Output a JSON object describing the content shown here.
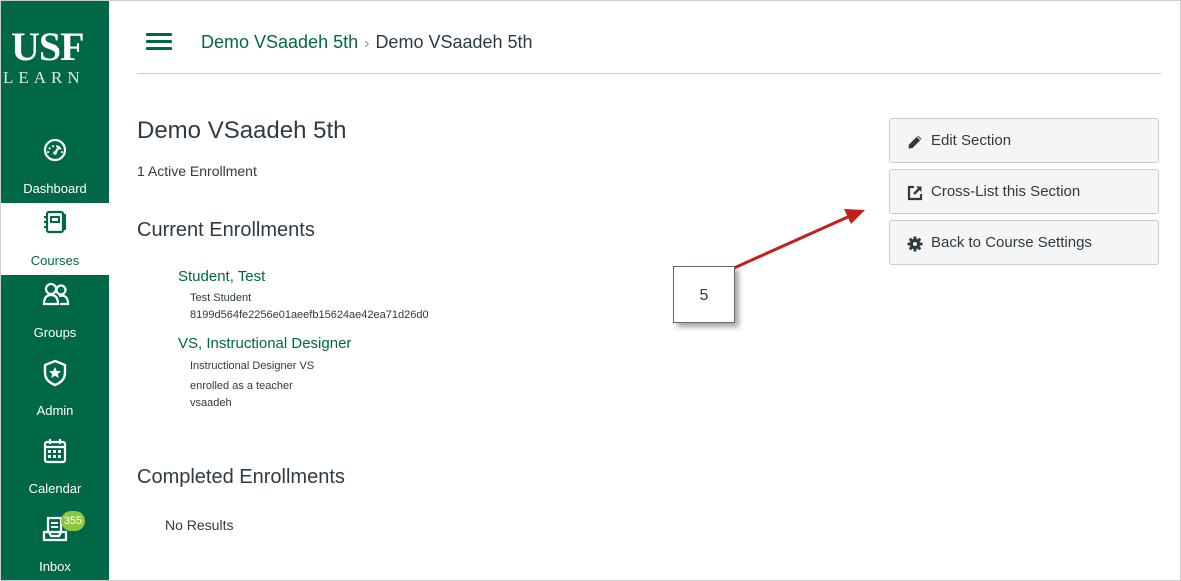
{
  "nav": {
    "logo": {
      "top": "USF",
      "bottom": "LEARN"
    },
    "items": [
      {
        "label": "Dashboard",
        "icon": "dashboard-icon",
        "active": false
      },
      {
        "label": "Courses",
        "icon": "courses-icon",
        "active": true
      },
      {
        "label": "Groups",
        "icon": "groups-icon",
        "active": false
      },
      {
        "label": "Admin",
        "icon": "admin-shield-icon",
        "active": false
      },
      {
        "label": "Calendar",
        "icon": "calendar-icon",
        "active": false
      },
      {
        "label": "Inbox",
        "icon": "inbox-icon",
        "active": false,
        "badge": "355"
      }
    ]
  },
  "header": {
    "breadcrumb": [
      {
        "label": "Demo VSaadeh 5th",
        "link": true
      },
      {
        "label": "Demo VSaadeh 5th",
        "link": false
      }
    ],
    "separator": "›"
  },
  "main": {
    "title": "Demo VSaadeh 5th",
    "subtitle": "1 Active Enrollment",
    "current_heading": "Current Enrollments",
    "current_enrollments": [
      {
        "name": "Student, Test",
        "lines": [
          "Test Student",
          "8199d564fe2256e01aeefb15624ae42ea71d26d0"
        ]
      },
      {
        "name": "VS, Instructional Designer",
        "lines": [
          "Instructional Designer VS",
          "enrolled as a teacher",
          "vsaadeh"
        ]
      }
    ],
    "completed_heading": "Completed Enrollments",
    "completed_empty": "No Results"
  },
  "sidebar": {
    "buttons": [
      {
        "label": "Edit Section",
        "icon": "pencil-icon"
      },
      {
        "label": "Cross-List this Section",
        "icon": "external-link-icon"
      },
      {
        "label": "Back to Course Settings",
        "icon": "gear-icon"
      }
    ]
  },
  "annotation": {
    "step": "5"
  },
  "colors": {
    "brand": "#006747",
    "badge": "#8dc63f",
    "arrow": "#c0201e"
  }
}
